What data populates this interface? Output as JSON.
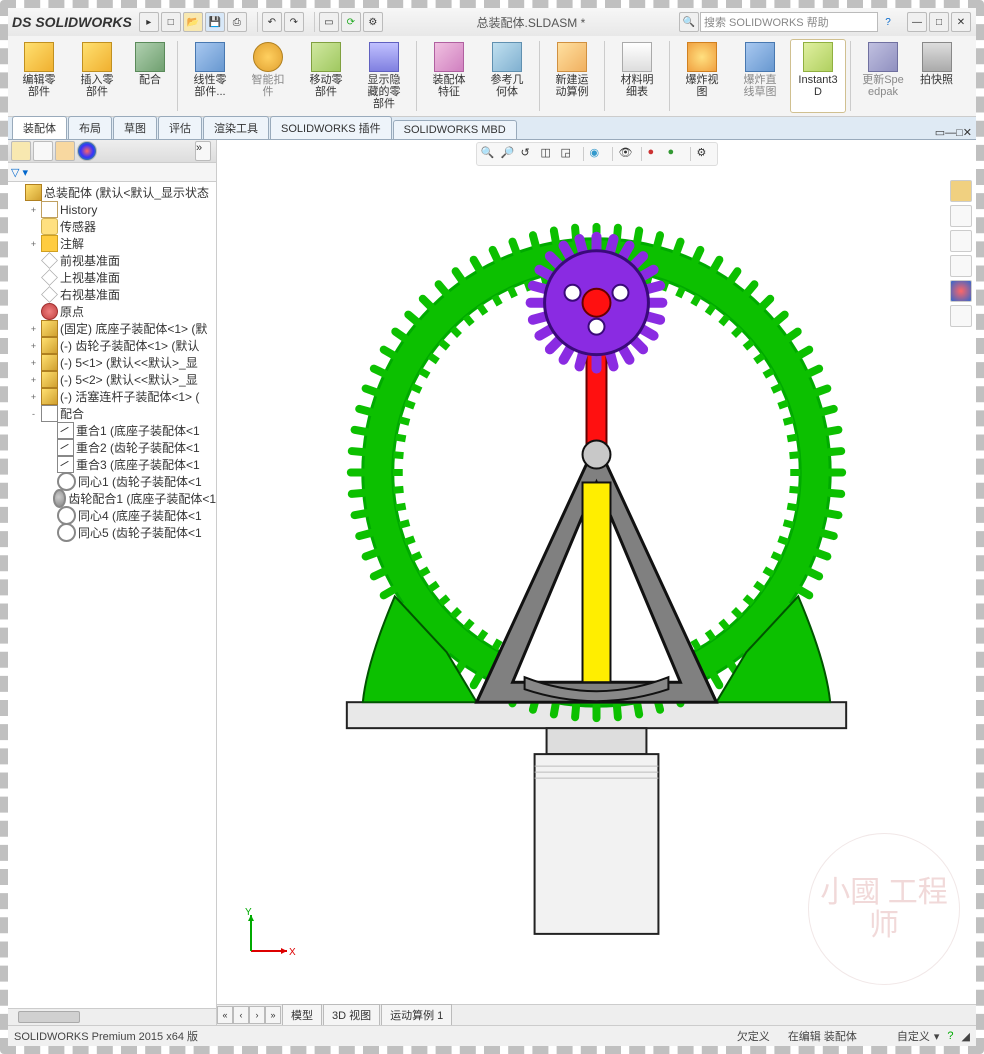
{
  "app": {
    "name": "SOLIDWORKS",
    "doc_title": "总装配体.SLDASM *"
  },
  "search": {
    "placeholder": "搜索 SOLIDWORKS 帮助"
  },
  "ribbon": [
    {
      "id": "edit-part",
      "label": "编辑零部件"
    },
    {
      "id": "insert-part",
      "label": "插入零部件"
    },
    {
      "id": "mate",
      "label": "配合"
    },
    {
      "id": "linear-pattern",
      "label": "线性零部件..."
    },
    {
      "id": "smart-fastener",
      "label": "智能扣件"
    },
    {
      "id": "move-part",
      "label": "移动零部件"
    },
    {
      "id": "show-hide",
      "label": "显示隐藏的零部件"
    },
    {
      "id": "asm-feature",
      "label": "装配体特征"
    },
    {
      "id": "ref-geom",
      "label": "参考几何体"
    },
    {
      "id": "new-motion",
      "label": "新建运动算例"
    },
    {
      "id": "bom",
      "label": "材料明细表"
    },
    {
      "id": "exploded",
      "label": "爆炸视图"
    },
    {
      "id": "expl-sketch",
      "label": "爆炸直线草图"
    },
    {
      "id": "instant3d",
      "label": "Instant3D"
    },
    {
      "id": "speedpak",
      "label": "更新Speedpak"
    },
    {
      "id": "snapshot",
      "label": "拍快照"
    }
  ],
  "tabs": [
    "装配体",
    "布局",
    "草图",
    "评估",
    "渲染工具",
    "SOLIDWORKS 插件",
    "SOLIDWORKS MBD"
  ],
  "tree": [
    {
      "d": 1,
      "exp": "",
      "ic": "ti-asm",
      "t": "总装配体  (默认<默认_显示状态"
    },
    {
      "d": 2,
      "exp": "+",
      "ic": "ti-hist",
      "t": "History"
    },
    {
      "d": 2,
      "exp": "",
      "ic": "ti-sens",
      "t": "传感器"
    },
    {
      "d": 2,
      "exp": "+",
      "ic": "ti-ann",
      "t": "注解"
    },
    {
      "d": 2,
      "exp": "",
      "ic": "ti-pln",
      "t": "前视基准面"
    },
    {
      "d": 2,
      "exp": "",
      "ic": "ti-pln",
      "t": "上视基准面"
    },
    {
      "d": 2,
      "exp": "",
      "ic": "ti-pln",
      "t": "右视基准面"
    },
    {
      "d": 2,
      "exp": "",
      "ic": "ti-org",
      "t": "原点"
    },
    {
      "d": 2,
      "exp": "+",
      "ic": "ti-prt",
      "t": "(固定) 底座子装配体<1> (默"
    },
    {
      "d": 2,
      "exp": "+",
      "ic": "ti-prt",
      "t": "(-) 齿轮子装配体<1> (默认"
    },
    {
      "d": 2,
      "exp": "+",
      "ic": "ti-prt",
      "t": "(-) 5<1> (默认<<默认>_显"
    },
    {
      "d": 2,
      "exp": "+",
      "ic": "ti-prt",
      "t": "(-) 5<2> (默认<<默认>_显"
    },
    {
      "d": 2,
      "exp": "+",
      "ic": "ti-prt",
      "t": "(-) 活塞连杆子装配体<1> ("
    },
    {
      "d": 2,
      "exp": "-",
      "ic": "ti-mat",
      "t": "配合"
    },
    {
      "d": 3,
      "exp": "",
      "ic": "ti-m1",
      "t": "重合1 (底座子装配体<1"
    },
    {
      "d": 3,
      "exp": "",
      "ic": "ti-m1",
      "t": "重合2 (齿轮子装配体<1"
    },
    {
      "d": 3,
      "exp": "",
      "ic": "ti-m1",
      "t": "重合3 (底座子装配体<1"
    },
    {
      "d": 3,
      "exp": "",
      "ic": "ti-m2",
      "t": "同心1 (齿轮子装配体<1"
    },
    {
      "d": 3,
      "exp": "",
      "ic": "ti-m3",
      "t": "齿轮配合1 (底座子装配体<1"
    },
    {
      "d": 3,
      "exp": "",
      "ic": "ti-m2",
      "t": "同心4 (底座子装配体<1"
    },
    {
      "d": 3,
      "exp": "",
      "ic": "ti-m2",
      "t": "同心5 (齿轮子装配体<1"
    }
  ],
  "viewport_tabs": [
    "模型",
    "3D 视图",
    "运动算例 1"
  ],
  "triad": {
    "x": "X",
    "y": "Y"
  },
  "status": {
    "version": "SOLIDWORKS Premium 2015 x64 版",
    "def": "欠定义",
    "mode": "在编辑 装配体",
    "custom": "自定义"
  },
  "watermark": "小國\n工程师"
}
